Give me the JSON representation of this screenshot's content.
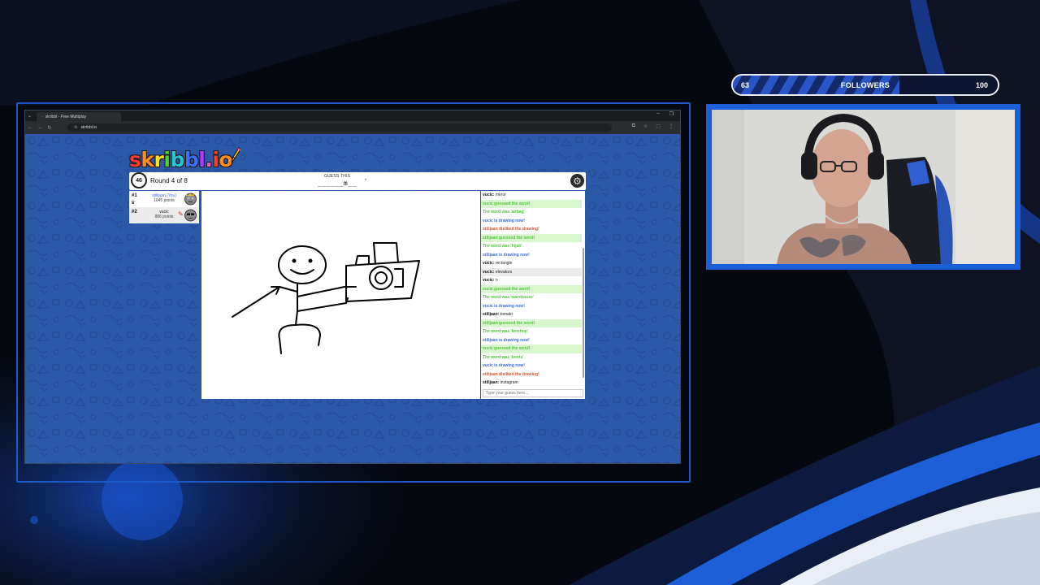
{
  "browser": {
    "tab_title": "skribbl - Free Multiplay",
    "url": "skribbl.io"
  },
  "game": {
    "logo": [
      "s",
      "k",
      "r",
      "i",
      "b",
      "b",
      "l",
      ".",
      "i",
      "o"
    ],
    "logo_colors": [
      "#ff3b2f",
      "#ff8c1a",
      "#ffe11a",
      "#46d62b",
      "#22c7d6",
      "#3a6fff",
      "#b23aff",
      "#ff5dd0",
      "#ff3b2f",
      "#ff8c1a"
    ],
    "timer": "46",
    "round": "Round 4 of 8",
    "guess_label": "GUESS THIS",
    "word_hint": "______m__",
    "word_length": "9",
    "players": [
      {
        "rank": "#1",
        "name": "stilijaan (You)",
        "points": "1045 points"
      },
      {
        "rank": "#2",
        "name": "vucic",
        "points": "886 points"
      }
    ],
    "chat": [
      {
        "type": "msg",
        "author": "vucic:",
        "text": "mirror"
      },
      {
        "type": "guessed",
        "text": "vucic guessed the word!"
      },
      {
        "type": "reveal",
        "text": "The word was 'airbag'"
      },
      {
        "type": "drawing",
        "text": "vucic is drawing now!"
      },
      {
        "type": "disliked",
        "text": "stilijaan disliked the drawing!"
      },
      {
        "type": "guessed",
        "text": "stilijaan guessed the word!"
      },
      {
        "type": "reveal",
        "text": "The word was 'hijab'"
      },
      {
        "type": "drawing",
        "text": "stilijaan is drawing now!"
      },
      {
        "type": "msg",
        "author": "vucic:",
        "text": "rectangle"
      },
      {
        "type": "msg",
        "author": "vucic:",
        "text": "elevators"
      },
      {
        "type": "msg",
        "author": "vucic:",
        "text": "o"
      },
      {
        "type": "guessed",
        "text": "vucic guessed the word!"
      },
      {
        "type": "reveal",
        "text": "The word was 'warehouse'"
      },
      {
        "type": "drawing",
        "text": "vucic is drawing now!"
      },
      {
        "type": "msg",
        "author": "stilijaan:",
        "text": "tomato"
      },
      {
        "type": "guessed",
        "text": "stilijaan guessed the word!"
      },
      {
        "type": "reveal",
        "text": "The word was 'ketchup'"
      },
      {
        "type": "drawing",
        "text": "stilijaan is drawing now!"
      },
      {
        "type": "guessed",
        "text": "vucic guessed the word!"
      },
      {
        "type": "reveal",
        "text": "The word was 'boots'"
      },
      {
        "type": "drawing",
        "text": "vucic is drawing now!"
      },
      {
        "type": "disliked",
        "text": "stilijaan disliked the drawing!"
      },
      {
        "type": "msg",
        "author": "stilijaan:",
        "text": "instagram"
      }
    ],
    "chat_placeholder": "Type your guess here..."
  },
  "followers": {
    "current": "63",
    "label": "FOLLOWERS",
    "goal": "100",
    "progress_fraction": 0.63
  }
}
